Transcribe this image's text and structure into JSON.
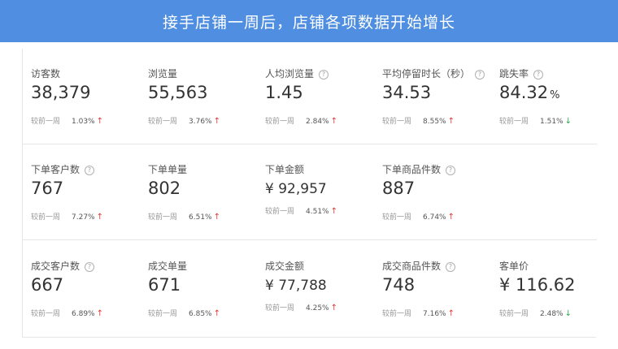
{
  "header": {
    "title": "接手店铺一周后，店铺各项数据开始增长"
  },
  "compare_label": "较前一周",
  "colors": {
    "banner": "#4f8ee0",
    "up": "#e0382f",
    "down": "#2fa84f"
  },
  "rows": [
    {
      "metrics": [
        {
          "label": "访客数",
          "value": "38,379",
          "change": "1.03%",
          "trend": "up",
          "help": false
        },
        {
          "label": "浏览量",
          "value": "55,563",
          "change": "3.76%",
          "trend": "up",
          "help": false
        },
        {
          "label": "人均浏览量",
          "value": "1.45",
          "change": "2.84%",
          "trend": "up",
          "help": true
        },
        {
          "label": "平均停留时长（秒）",
          "value": "34.53",
          "change": "8.55%",
          "trend": "up",
          "help": true
        },
        {
          "label": "跳失率",
          "value": "84.32",
          "unit": "%",
          "change": "1.51%",
          "trend": "down",
          "help": true
        }
      ]
    },
    {
      "metrics": [
        {
          "label": "下单客户数",
          "value": "767",
          "change": "7.27%",
          "trend": "up",
          "help": true
        },
        {
          "label": "下单单量",
          "value": "802",
          "change": "6.51%",
          "trend": "up",
          "help": false
        },
        {
          "label": "下单金额",
          "value": "¥ 92,957",
          "change": "4.51%",
          "trend": "up",
          "help": false
        },
        {
          "label": "下单商品件数",
          "value": "887",
          "change": "6.74%",
          "trend": "up",
          "help": true
        }
      ]
    },
    {
      "metrics": [
        {
          "label": "成交客户数",
          "value": "667",
          "change": "6.89%",
          "trend": "up",
          "help": true
        },
        {
          "label": "成交单量",
          "value": "671",
          "change": "6.85%",
          "trend": "up",
          "help": false
        },
        {
          "label": "成交金额",
          "value": "¥ 77,788",
          "change": "4.25%",
          "trend": "up",
          "help": false
        },
        {
          "label": "成交商品件数",
          "value": "748",
          "change": "7.16%",
          "trend": "up",
          "help": true
        },
        {
          "label": "客单价",
          "value": "¥ 116.62",
          "change": "2.48%",
          "trend": "down",
          "help": false
        }
      ]
    }
  ]
}
